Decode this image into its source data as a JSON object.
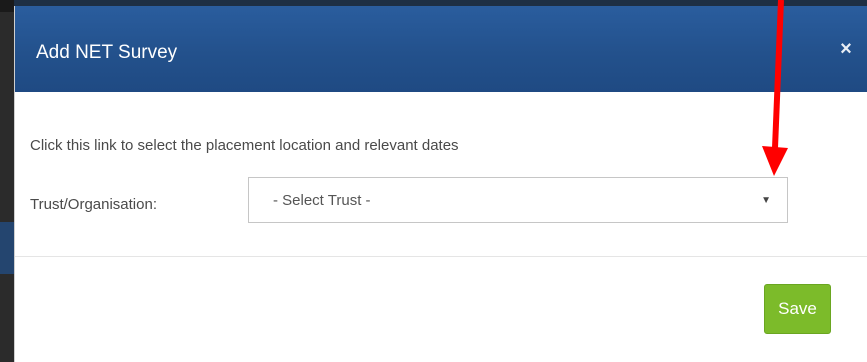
{
  "modal": {
    "title": "Add NET Survey",
    "close_glyph": "×",
    "instruction": "Click this link to select the placement location and relevant dates",
    "trust_label": "Trust/Organisation:",
    "trust_select": {
      "selected": "- Select Trust -",
      "caret_glyph": "▼"
    },
    "save_label": "Save"
  },
  "colors": {
    "header_blue": "#23518c",
    "save_green": "#7cbb2a",
    "annotation_red": "#ff0000"
  },
  "icons": {
    "close": "close-icon",
    "caret": "caret-down-icon",
    "annotation": "annotation-arrow"
  }
}
